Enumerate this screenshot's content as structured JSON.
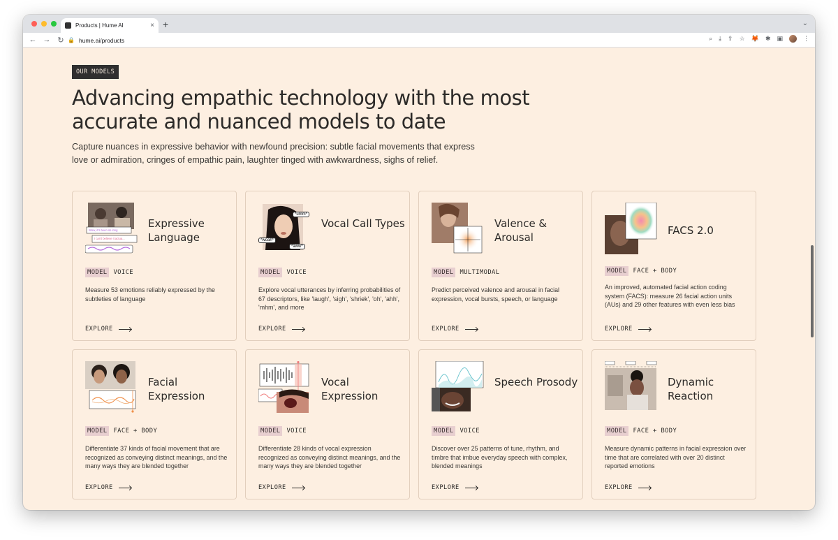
{
  "browser": {
    "tab_title": "Products | Hume AI",
    "tab_close": "×",
    "new_tab": "+",
    "url": "hume.ai/products",
    "back": "←",
    "forward": "→",
    "reload": "↻",
    "lock": "🔒",
    "tools": [
      "⌕",
      "⤓",
      "⇪",
      "☆",
      "🦊",
      "✱",
      "▣",
      "⋮"
    ]
  },
  "page": {
    "eyebrow": "OUR MODELS",
    "headline": "Advancing empathic technology with the most accurate and nuanced models to date",
    "lede": "Capture nuances in expressive behavior with newfound precision: subtle facial movements that express love or admiration, cringes of empathic pain, laughter tinged with awkwardness, sighs of relief."
  },
  "cards": [
    {
      "title": "Expressive Language",
      "tag": "MODEL",
      "category": "VOICE",
      "desc": "Measure 53 emotions reliably expressed by the subtleties of language",
      "explore": "EXPLORE"
    },
    {
      "title": "Vocal Call Types",
      "tag": "MODEL",
      "category": "VOICE",
      "desc": "Explore vocal utterances by inferring probabilities of 67 descriptors, like 'laugh', 'sigh', 'shriek', 'oh', 'ahh', 'mhm', and more",
      "explore": "EXPLORE"
    },
    {
      "title": "Valence & Arousal",
      "tag": "MODEL",
      "category": "MULTIMODAL",
      "desc": "Predict perceived valence and arousal in facial expression, vocal bursts, speech, or language",
      "explore": "EXPLORE"
    },
    {
      "title": "FACS 2.0",
      "tag": "MODEL",
      "category": "FACE + BODY",
      "desc": "An improved, automated facial action coding system (FACS): measure 26 facial action units (AUs) and 29 other features with even less bias",
      "explore": "EXPLORE"
    },
    {
      "title": "Facial Expression",
      "tag": "MODEL",
      "category": "FACE + BODY",
      "desc": "Differentiate 37 kinds of facial movement that are recognized as conveying distinct meanings, and the many ways they are blended together",
      "explore": "EXPLORE"
    },
    {
      "title": "Vocal Expression",
      "tag": "MODEL",
      "category": "VOICE",
      "desc": "Differentiate 28 kinds of vocal expression recognized as conveying distinct meanings, and the many ways they are blended together",
      "explore": "EXPLORE"
    },
    {
      "title": "Speech Prosody",
      "tag": "MODEL",
      "category": "VOICE",
      "desc": "Discover over 25 patterns of tune, rhythm, and timbre that imbue everyday speech with complex, blended meanings",
      "explore": "EXPLORE"
    },
    {
      "title": "Dynamic Reaction",
      "tag": "MODEL",
      "category": "FACE + BODY",
      "desc": "Measure dynamic patterns in facial expression over time that are correlated with over 20 distinct reported emotions",
      "explore": "EXPLORE"
    }
  ],
  "art_text": {
    "lang_bubble1": "Wow, it's been so long",
    "lang_bubble2": "I can't believe it actua...",
    "call_umm": "*umm*",
    "call_woah": "*woah*",
    "call_aww": "*aww*"
  }
}
